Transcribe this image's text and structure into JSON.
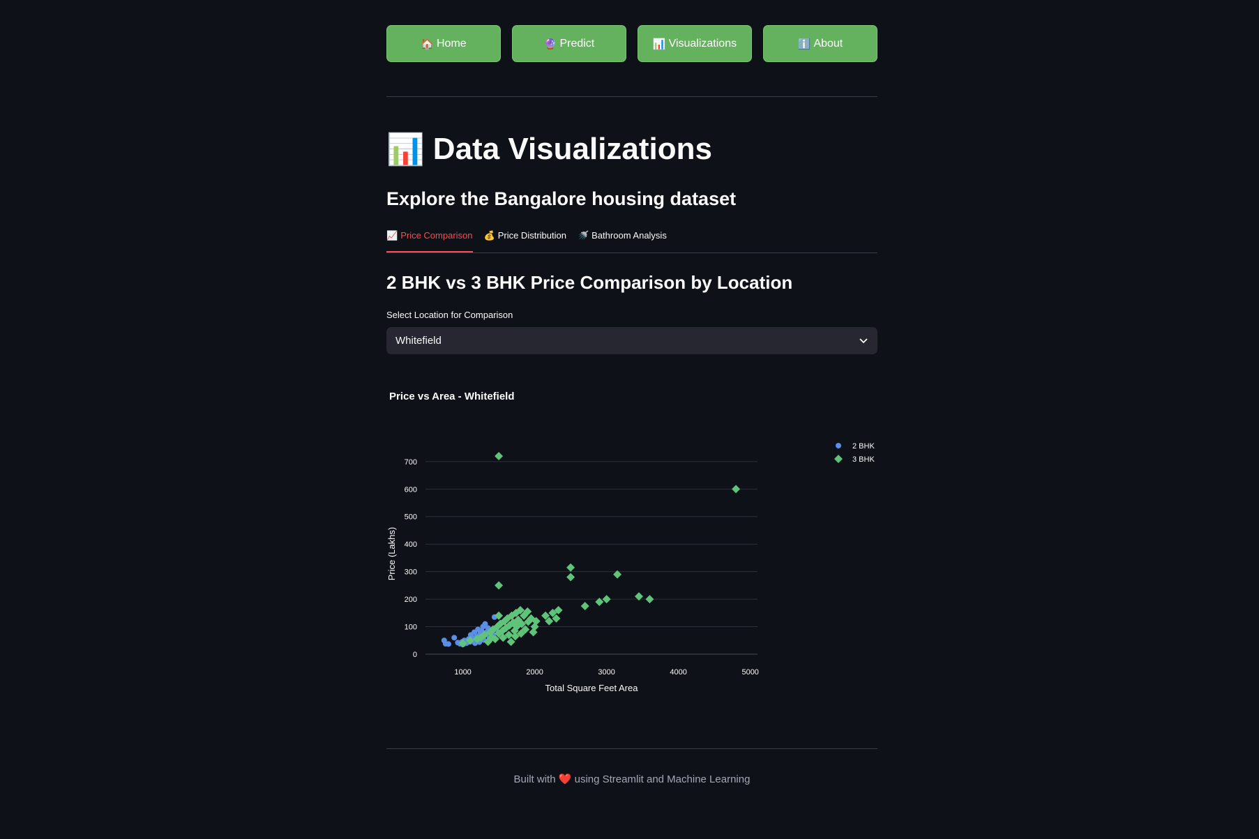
{
  "nav": [
    {
      "icon": "🏠",
      "icon_name": "home-icon",
      "label": "Home"
    },
    {
      "icon": "🔮",
      "icon_name": "crystal-ball-icon",
      "label": "Predict"
    },
    {
      "icon": "📊",
      "icon_name": "bar-chart-icon",
      "label": "Visualizations"
    },
    {
      "icon": "ℹ️",
      "icon_name": "info-icon",
      "label": "About"
    }
  ],
  "page": {
    "title_icon": "📊",
    "title": "Data Visualizations",
    "subtitle": "Explore the Bangalore housing dataset"
  },
  "tabs": [
    {
      "icon": "📈",
      "label": "Price Comparison",
      "active": true
    },
    {
      "icon": "💰",
      "label": "Price Distribution",
      "active": false
    },
    {
      "icon": "🚿",
      "label": "Bathroom Analysis",
      "active": false
    }
  ],
  "section": {
    "title": "2 BHK vs 3 BHK Price Comparison by Location",
    "select_label": "Select Location for Comparison",
    "select_value": "Whitefield"
  },
  "footer": {
    "prefix": "Built with",
    "heart": "❤️",
    "suffix": "using Streamlit and Machine Learning"
  },
  "colors": {
    "accent": "#ff4b4b",
    "nav_button": "#64b25e",
    "series_2bhk": "#5b8ee6",
    "series_3bhk": "#5fc47a"
  },
  "chart_data": {
    "type": "scatter",
    "title": "Price vs Area - Whitefield",
    "xlabel": "Total Square Feet Area",
    "ylabel": "Price (Lakhs)",
    "xlim": [
      480,
      5100
    ],
    "ylim": [
      0,
      730
    ],
    "xticks": [
      1000,
      2000,
      3000,
      4000,
      5000
    ],
    "yticks": [
      0,
      100,
      200,
      300,
      400,
      500,
      600,
      700
    ],
    "grid": true,
    "legend_position": "top-right",
    "series": [
      {
        "name": "2 BHK",
        "marker": "circle",
        "color": "#5b8ee6",
        "points": [
          [
            740,
            50
          ],
          [
            760,
            38
          ],
          [
            800,
            37
          ],
          [
            880,
            60
          ],
          [
            930,
            42
          ],
          [
            960,
            38
          ],
          [
            990,
            45
          ],
          [
            1000,
            35
          ],
          [
            1020,
            50
          ],
          [
            1050,
            40
          ],
          [
            1080,
            55
          ],
          [
            1100,
            45
          ],
          [
            1110,
            70
          ],
          [
            1130,
            60
          ],
          [
            1150,
            50
          ],
          [
            1160,
            80
          ],
          [
            1170,
            40
          ],
          [
            1190,
            65
          ],
          [
            1200,
            55
          ],
          [
            1210,
            90
          ],
          [
            1220,
            48
          ],
          [
            1240,
            75
          ],
          [
            1250,
            62
          ],
          [
            1260,
            85
          ],
          [
            1280,
            100
          ],
          [
            1300,
            70
          ],
          [
            1310,
            110
          ],
          [
            1330,
            80
          ],
          [
            1350,
            95
          ],
          [
            1370,
            60
          ],
          [
            1400,
            88
          ],
          [
            1420,
            72
          ],
          [
            1440,
            135
          ],
          [
            1460,
            90
          ],
          [
            1500,
            105
          ],
          [
            1550,
            115
          ],
          [
            1060,
            42
          ],
          [
            1140,
            58
          ],
          [
            1230,
            44
          ],
          [
            1290,
            52
          ]
        ]
      },
      {
        "name": "3 BHK",
        "marker": "diamond",
        "color": "#5fc47a",
        "points": [
          [
            1500,
            720
          ],
          [
            4800,
            600
          ],
          [
            1500,
            250
          ],
          [
            2500,
            315
          ],
          [
            2500,
            280
          ],
          [
            3150,
            290
          ],
          [
            3450,
            210
          ],
          [
            3600,
            200
          ],
          [
            3000,
            200
          ],
          [
            2900,
            190
          ],
          [
            2700,
            175
          ],
          [
            1000,
            40
          ],
          [
            1100,
            50
          ],
          [
            1200,
            55
          ],
          [
            1250,
            60
          ],
          [
            1300,
            70
          ],
          [
            1350,
            45
          ],
          [
            1380,
            80
          ],
          [
            1400,
            60
          ],
          [
            1420,
            90
          ],
          [
            1450,
            55
          ],
          [
            1480,
            100
          ],
          [
            1500,
            75
          ],
          [
            1500,
            140
          ],
          [
            1520,
            110
          ],
          [
            1550,
            85
          ],
          [
            1560,
            60
          ],
          [
            1580,
            120
          ],
          [
            1600,
            95
          ],
          [
            1620,
            130
          ],
          [
            1640,
            70
          ],
          [
            1650,
            105
          ],
          [
            1670,
            45
          ],
          [
            1680,
            140
          ],
          [
            1700,
            115
          ],
          [
            1720,
            85
          ],
          [
            1740,
            150
          ],
          [
            1750,
            100
          ],
          [
            1770,
            125
          ],
          [
            1800,
            160
          ],
          [
            1820,
            110
          ],
          [
            1850,
            140
          ],
          [
            1870,
            90
          ],
          [
            1900,
            155
          ],
          [
            1950,
            130
          ],
          [
            1980,
            80
          ],
          [
            2000,
            100
          ],
          [
            2020,
            120
          ],
          [
            2150,
            140
          ],
          [
            2200,
            120
          ],
          [
            2250,
            150
          ],
          [
            2300,
            130
          ],
          [
            2330,
            160
          ],
          [
            1730,
            65
          ],
          [
            1810,
            75
          ],
          [
            1910,
            118
          ]
        ]
      }
    ]
  }
}
